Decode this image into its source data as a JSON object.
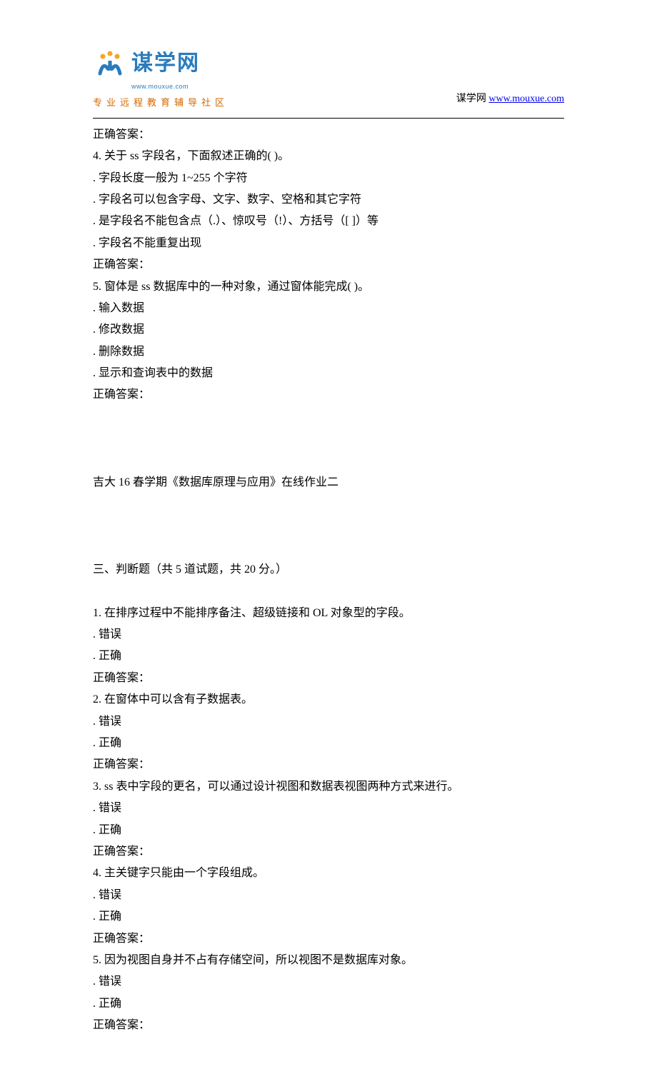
{
  "header": {
    "logo_cn": "谋学网",
    "logo_url": "www.mouxue.com",
    "tagline": "专业远程教育辅导社区",
    "site_label": "谋学网",
    "site_link_text": "www.mouxue.com",
    "site_link_href": "http://www.mouxue.com"
  },
  "body": {
    "topAnswerLabel": "正确答案：",
    "q4": {
      "stem": "4.  关于 ss 字段名，下面叙述正确的( )。",
      "opts": [
        ". 字段长度一般为 1~255 个字符",
        ". 字段名可以包含字母、文字、数字、空格和其它字符",
        ". 是字段名不能包含点（.）、惊叹号（!）、方括号（[ ]）等",
        ". 字段名不能重复出现"
      ],
      "answerLabel": "正确答案："
    },
    "q5": {
      "stem": "5.  窗体是 ss 数据库中的一种对象，通过窗体能完成( )。",
      "opts": [
        ". 输入数据",
        ". 修改数据",
        ". 删除数据",
        ". 显示和查询表中的数据"
      ],
      "answerLabel": "正确答案："
    },
    "sectionTitle": "吉大 16 春学期《数据库原理与应用》在线作业二",
    "sectionSub": "三、判断题（共 5 道试题，共 20 分。）",
    "tf": [
      {
        "stem": "1.  在排序过程中不能排序备注、超级链接和 OL 对象型的字段。",
        "opts": [
          ". 错误",
          ". 正确"
        ],
        "answerLabel": "正确答案："
      },
      {
        "stem": "2.  在窗体中可以含有子数据表。",
        "opts": [
          ". 错误",
          ". 正确"
        ],
        "answerLabel": "正确答案："
      },
      {
        "stem": "3.  ss 表中字段的更名，可以通过设计视图和数据表视图两种方式来进行。",
        "opts": [
          ". 错误",
          ". 正确"
        ],
        "answerLabel": "正确答案："
      },
      {
        "stem": "4.  主关键字只能由一个字段组成。",
        "opts": [
          ". 错误",
          ". 正确"
        ],
        "answerLabel": "正确答案："
      },
      {
        "stem": "5.  因为视图自身并不占有存储空间，所以视图不是数据库对象。",
        "opts": [
          ". 错误",
          ". 正确"
        ],
        "answerLabel": "正确答案："
      }
    ]
  }
}
